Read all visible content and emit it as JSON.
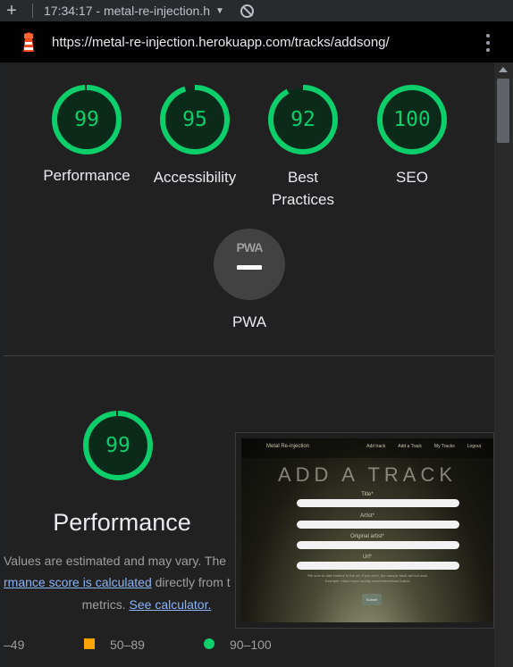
{
  "tab": {
    "time": "17:34:17",
    "title": "metal-re-injection.h"
  },
  "address": {
    "url": "https://metal-re-injection.herokuapp.com/tracks/addsong/"
  },
  "scores": [
    {
      "value": "99",
      "label": "Performance",
      "label2": ""
    },
    {
      "value": "95",
      "label": "Accessibility",
      "label2": ""
    },
    {
      "value": "92",
      "label": "Best",
      "label2": "Practices"
    },
    {
      "value": "100",
      "label": "SEO",
      "label2": ""
    }
  ],
  "pwa": {
    "badge": "PWA",
    "label": "PWA"
  },
  "performance": {
    "score": "99",
    "title": "Performance",
    "note1": "Values are estimated and may vary. The",
    "note2_link": "rmance score is calculated",
    "note2_text": " directly from t",
    "note3_text": "metrics. ",
    "note3_link": "See calculator."
  },
  "screenshot": {
    "brand": "Metal Re-injection",
    "nav": [
      "Add track",
      "Add a Track",
      "My Tracks",
      "Logout"
    ],
    "heading": "ADD A TRACK",
    "fields": [
      "Title*",
      "Artist*",
      "Original artist*",
      "Url*"
    ],
    "hint1": "*Be sure to add embed/ to the url, if you don't, the sample track will not work",
    "hint2": "Example: https://open.spotify.com/embed/track/1abcd",
    "submit": "Submit"
  },
  "legend": {
    "low": "–49",
    "mid": "50–89",
    "high": "90–100"
  },
  "colors": {
    "pass": "#0cce6b",
    "average": "#ffa400",
    "link": "#8ab4f8"
  }
}
